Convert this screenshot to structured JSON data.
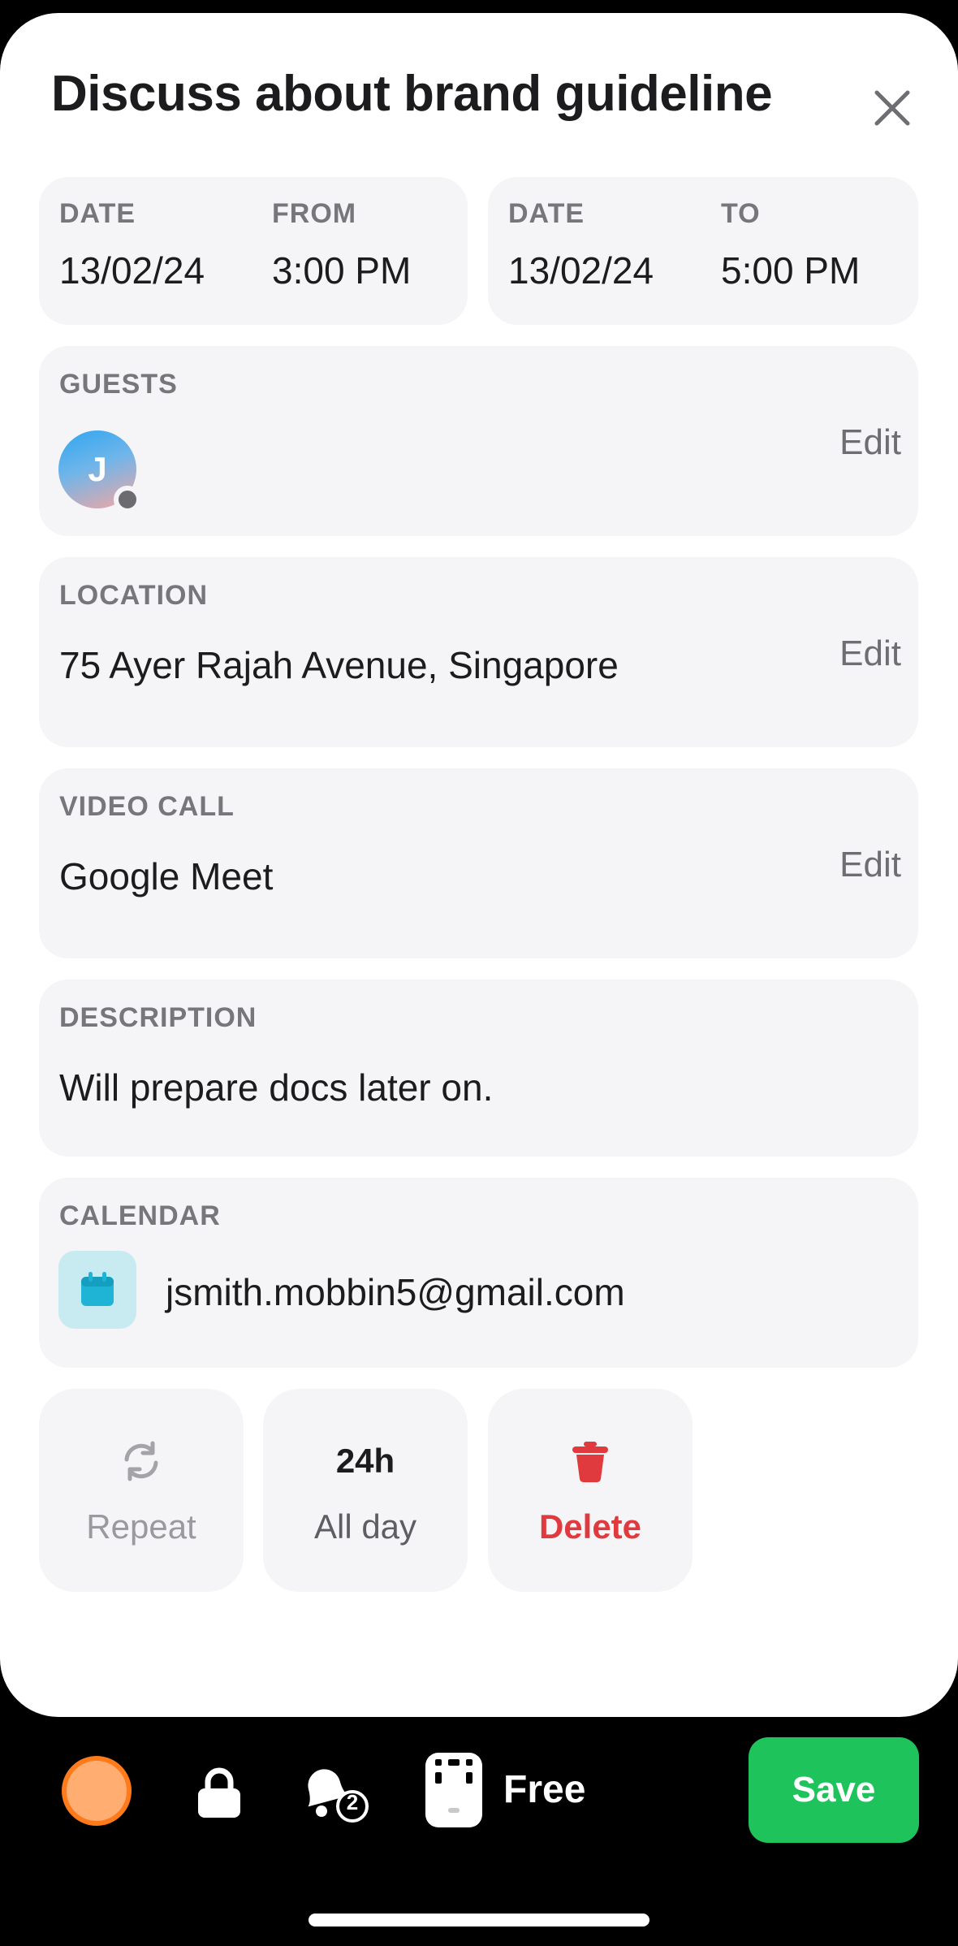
{
  "event": {
    "title": "Discuss about brand guideline"
  },
  "start": {
    "date_label": "DATE",
    "date": "13/02/24",
    "time_label": "FROM",
    "time": "3:00 PM"
  },
  "end": {
    "date_label": "DATE",
    "date": "13/02/24",
    "time_label": "TO",
    "time": "5:00 PM"
  },
  "guests": {
    "label": "GUESTS",
    "avatar_initial": "J",
    "edit_label": "Edit"
  },
  "location": {
    "label": "LOCATION",
    "value": "75 Ayer Rajah Avenue, Singapore",
    "edit_label": "Edit"
  },
  "video_call": {
    "label": "VIDEO CALL",
    "value": "Google Meet",
    "edit_label": "Edit"
  },
  "description": {
    "label": "DESCRIPTION",
    "value": "Will prepare docs later on."
  },
  "calendar": {
    "label": "CALENDAR",
    "account": "jsmith.mobbin5@gmail.com"
  },
  "actions": {
    "repeat_label": "Repeat",
    "allday_badge": "24h",
    "allday_label": "All day",
    "delete_label": "Delete"
  },
  "toolbar": {
    "notification_count": "2",
    "availability_label": "Free",
    "save_label": "Save"
  },
  "colors": {
    "accent_green": "#1fc35b",
    "delete_red": "#e0393e",
    "event_color_orange": "#ffad70",
    "calendar_icon": "#1fb3d6"
  },
  "icons": {
    "close": "close-icon",
    "calendar": "calendar-icon",
    "repeat": "repeat-icon",
    "delete": "trash-icon",
    "lock": "lock-icon",
    "notification": "bell-icon",
    "availability": "busy-free-icon"
  }
}
